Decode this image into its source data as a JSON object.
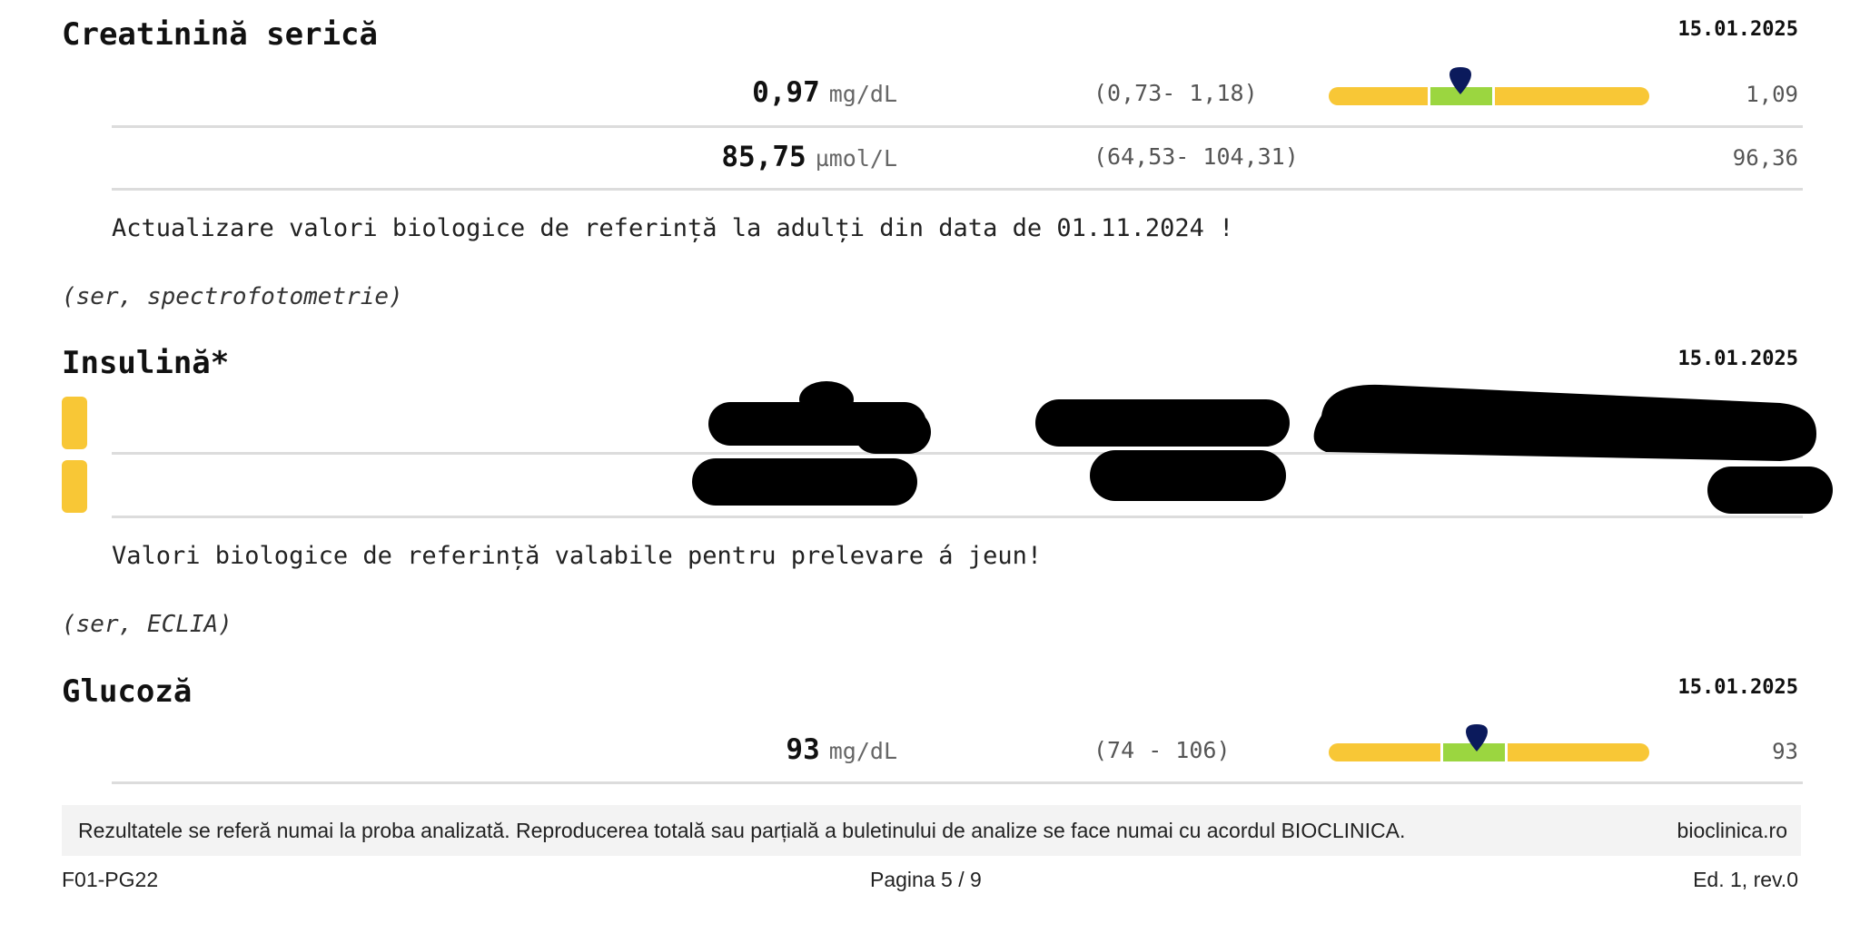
{
  "tests": [
    {
      "name": "Creatinină serică",
      "date": "15.01.2025",
      "rows": [
        {
          "value": "0,97",
          "unit": "mg/dL",
          "range": "(0,73- 1,18)",
          "previous": "1,09",
          "gauge_position": 0.42
        },
        {
          "value": "85,75",
          "unit": "µmol/L",
          "range": "(64,53- 104,31)",
          "previous": "96,36"
        }
      ],
      "note": "Actualizare valori biologice de referință la adulți din data de 01.11.2024 !",
      "method": "(ser, spectrofotometrie)"
    },
    {
      "name": "Insulină*",
      "date": "15.01.2025",
      "note": "Valori biologice de referință valabile pentru prelevare á jeun!",
      "method": "(ser, ECLIA)"
    },
    {
      "name": "Glucoză",
      "date": "15.01.2025",
      "rows": [
        {
          "value": "93",
          "unit": "mg/dL",
          "range": "(74 - 106)",
          "previous": "93",
          "gauge_position": 0.47
        }
      ]
    }
  ],
  "footer": {
    "disclaimer": "Rezultatele se referă numai la proba analizată. Reproducerea totală sau parțială a buletinului de analize se face numai cu acordul BIOCLINICA.",
    "website": "bioclinica.ro",
    "form_code": "F01-PG22",
    "page": "Pagina 5 / 9",
    "edition": "Ed. 1, rev.0"
  },
  "colors": {
    "gauge_out_of_range": "#f8c736",
    "gauge_in_range": "#9bd640",
    "marker": "#0b1a5c",
    "flag": "#f8c736",
    "redaction": "#000000"
  }
}
